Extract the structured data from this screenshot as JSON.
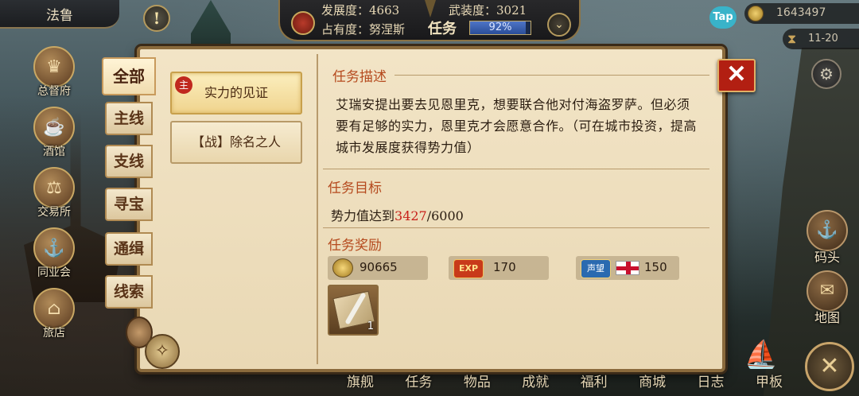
{
  "header": {
    "city_name": "法鲁",
    "development_label": "发展度：4663",
    "armament_label": "武装度：3021",
    "occupation_label": "占有度：努涅斯",
    "mission_tab": "任务",
    "mission_progress_text": "92%",
    "mission_progress_value": 0.92,
    "tap_label": "Tap",
    "gold": "1643497",
    "date": "11-20",
    "alert_symbol": "!",
    "expand_symbol": "⌄",
    "settings_icon": "gear-icon"
  },
  "left_buildings": [
    {
      "label": "总督府",
      "icon": "crown-icon"
    },
    {
      "label": "酒馆",
      "icon": "beer-icon"
    },
    {
      "label": "交易所",
      "icon": "scales-icon"
    },
    {
      "label": "同业会",
      "icon": "guild-icon"
    },
    {
      "label": "旅店",
      "icon": "inn-icon"
    }
  ],
  "right_buttons": [
    {
      "label": "码头",
      "icon": "dock-icon"
    },
    {
      "label": "地图",
      "icon": "map-icon"
    }
  ],
  "bottom_nav": [
    "旗舰",
    "任务",
    "物品",
    "成就",
    "福利",
    "商城",
    "日志",
    "甲板"
  ],
  "filter_tabs": [
    {
      "label": "全部",
      "active": true
    },
    {
      "label": "主线",
      "active": false
    },
    {
      "label": "支线",
      "active": false
    },
    {
      "label": "寻宝",
      "active": false
    },
    {
      "label": "通缉",
      "active": false
    },
    {
      "label": "线索",
      "active": false
    }
  ],
  "quests": [
    {
      "label": "实力的见证",
      "tag": "主",
      "selected": true
    },
    {
      "label": "【战】除名之人",
      "tag": "",
      "selected": false
    }
  ],
  "detail": {
    "description_title": "任务描述",
    "description": "艾瑞安提出要去见恩里克，想要联合他对付海盗罗萨。但必须要有足够的实力，恩里克才会愿意合作。（可在城市投资，提高城市发展度获得势力值）",
    "goal_title": "任务目标",
    "goal_prefix": "势力值达到",
    "goal_current": "3427",
    "goal_total": "/6000",
    "reward_title": "任务奖励",
    "rewards": [
      {
        "type": "gold",
        "icon": "coin-icon",
        "value": "90665"
      },
      {
        "type": "exp",
        "badge": "EXP",
        "value": "170"
      },
      {
        "type": "fame",
        "badge": "声望",
        "value": "150"
      }
    ],
    "item": {
      "icon": "scroll-quill-icon",
      "count": "1"
    }
  },
  "close_symbol": "✕",
  "colors": {
    "accent_red": "#c8201a",
    "title_orange": "#b54a1e",
    "parchment": "#f2e4c6"
  }
}
